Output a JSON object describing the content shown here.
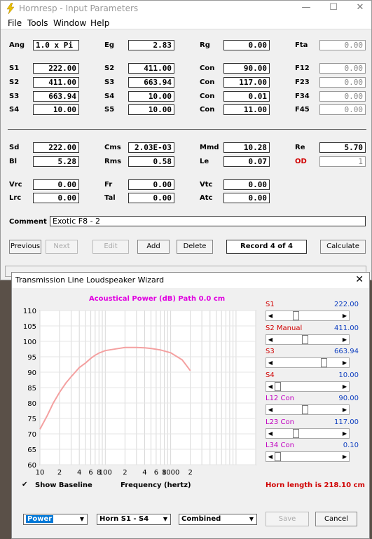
{
  "win1": {
    "title": "Hornresp - Input Parameters",
    "menu": [
      "File",
      "Tools",
      "Window",
      "Help"
    ],
    "row1": [
      {
        "label": "Ang",
        "value": "1.0 x Pi",
        "left": true
      },
      {
        "label": "Eg",
        "value": "2.83"
      },
      {
        "label": "Rg",
        "value": "0.00"
      },
      {
        "label": "Fta",
        "value": "0.00",
        "dis": true
      }
    ],
    "grid": [
      [
        {
          "label": "S1",
          "value": "222.00"
        },
        {
          "label": "S2",
          "value": "411.00"
        },
        {
          "label": "Con",
          "value": "90.00"
        },
        {
          "label": "F12",
          "value": "0.00",
          "dis": true
        }
      ],
      [
        {
          "label": "S2",
          "value": "411.00"
        },
        {
          "label": "S3",
          "value": "663.94"
        },
        {
          "label": "Con",
          "value": "117.00"
        },
        {
          "label": "F23",
          "value": "0.00",
          "dis": true
        }
      ],
      [
        {
          "label": "S3",
          "value": "663.94"
        },
        {
          "label": "S4",
          "value": "10.00"
        },
        {
          "label": "Con",
          "value": "0.01"
        },
        {
          "label": "F34",
          "value": "0.00",
          "dis": true
        }
      ],
      [
        {
          "label": "S4",
          "value": "10.00"
        },
        {
          "label": "S5",
          "value": "10.00"
        },
        {
          "label": "Con",
          "value": "11.00"
        },
        {
          "label": "F45",
          "value": "0.00",
          "dis": true
        }
      ]
    ],
    "driver": [
      [
        {
          "label": "Sd",
          "value": "222.00"
        },
        {
          "label": "Cms",
          "value": "2.03E-03"
        },
        {
          "label": "Mmd",
          "value": "10.28"
        },
        {
          "label": "Re",
          "value": "5.70"
        }
      ],
      [
        {
          "label": "Bl",
          "value": "5.28"
        },
        {
          "label": "Rms",
          "value": "0.58"
        },
        {
          "label": "Le",
          "value": "0.07"
        },
        {
          "label": "OD",
          "value": "1",
          "red": true,
          "dis": true
        }
      ]
    ],
    "chamber": [
      [
        {
          "label": "Vrc",
          "value": "0.00"
        },
        {
          "label": "Fr",
          "value": "0.00"
        },
        {
          "label": "Vtc",
          "value": "0.00"
        }
      ],
      [
        {
          "label": "Lrc",
          "value": "0.00"
        },
        {
          "label": "Tal",
          "value": "0.00"
        },
        {
          "label": "Atc",
          "value": "0.00"
        }
      ]
    ],
    "comment_label": "Comment",
    "comment": "Exotic F8 - 2",
    "buttons": {
      "previous": "Previous",
      "next": "Next",
      "edit": "Edit",
      "add": "Add",
      "delete": "Delete",
      "record": "Record 4 of 4",
      "calculate": "Calculate"
    }
  },
  "win2": {
    "title": "Transmission Line Loudspeaker Wizard",
    "close": "✕",
    "chart_title": "Acoustical Power (dB)   Path 0.0 cm",
    "xlabel": "Frequency (hertz)",
    "show_baseline": "Show Baseline",
    "horn_length": "Horn length is 218.10 cm",
    "sliders": [
      {
        "label": "S1",
        "value": "222.00",
        "color": "#d00000",
        "pos": 0.31
      },
      {
        "label": "S2  Manual",
        "value": "411.00",
        "color": "#d00000",
        "pos": 0.46
      },
      {
        "label": "S3",
        "value": "663.94",
        "color": "#d00000",
        "pos": 0.78
      },
      {
        "label": "S4",
        "value": "10.00",
        "color": "#d00000",
        "pos": 0.0
      },
      {
        "label": "L12  Con",
        "value": "90.00",
        "color": "#c000c0",
        "pos": 0.46
      },
      {
        "label": "L23  Con",
        "value": "117.00",
        "color": "#c000c0",
        "pos": 0.31
      },
      {
        "label": "L34  Con",
        "value": "0.10",
        "color": "#c000c0",
        "pos": 0.0
      }
    ],
    "selects": {
      "mode": "Power",
      "horn": "Horn S1 - S4",
      "combined": "Combined"
    },
    "save": "Save",
    "cancel": "Cancel"
  },
  "chart_data": {
    "type": "line",
    "title": "Acoustical Power (dB)   Path 0.0 cm",
    "xlabel": "Frequency (hertz)",
    "ylabel": "",
    "xscale": "log",
    "xlim": [
      10,
      20000
    ],
    "ylim": [
      60,
      110
    ],
    "yticks": [
      60,
      65,
      70,
      75,
      80,
      85,
      90,
      95,
      100,
      105,
      110
    ],
    "xtick_labels": [
      "10",
      "2",
      "4",
      "6",
      "8",
      "100",
      "2",
      "4",
      "6",
      "8",
      "1000",
      "2"
    ],
    "grid": true,
    "series": [
      {
        "color": "#f4a0a0",
        "x": [
          10,
          13,
          16,
          20,
          25,
          30,
          40,
          50,
          60,
          70,
          80,
          100,
          150,
          200,
          300,
          400,
          500,
          700,
          1000,
          1500,
          2000
        ],
        "y": [
          71.5,
          76,
          80,
          83.5,
          86.5,
          88.5,
          91.5,
          93,
          94.5,
          95.5,
          96.2,
          97,
          97.6,
          98,
          98,
          97.9,
          97.7,
          97.2,
          96.3,
          94,
          90.5
        ]
      }
    ]
  }
}
